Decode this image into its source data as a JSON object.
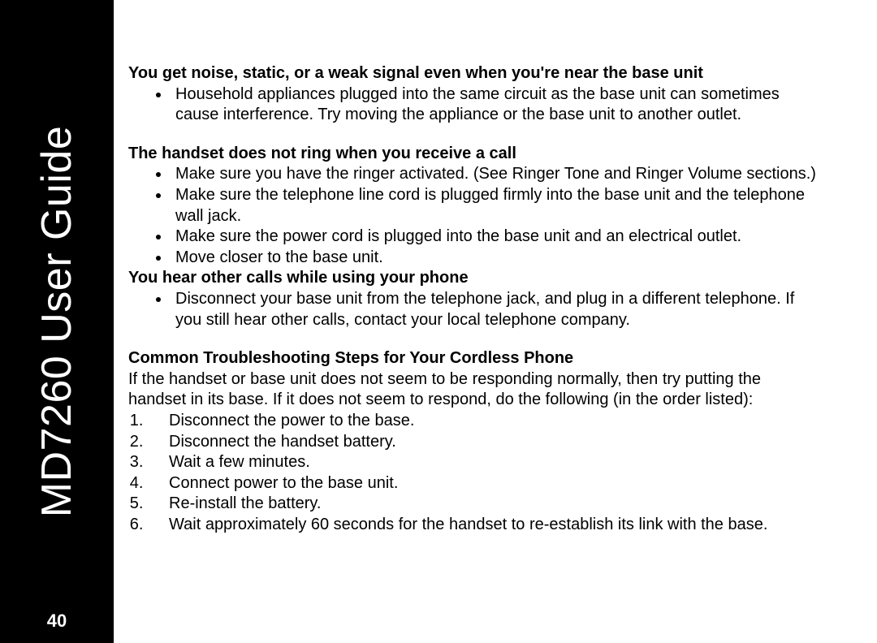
{
  "sidebar": {
    "title": "MD7260 User Guide",
    "page_number": "40"
  },
  "sections": [
    {
      "heading": "You get noise, static, or a weak signal even when you're near the base unit",
      "bullets": [
        "Household appliances plugged into the same circuit as the base unit can sometimes cause interference. Try moving the appliance or the base unit to another outlet."
      ]
    },
    {
      "heading": "The handset does not ring when you receive a call",
      "bullets": [
        "Make sure you have the ringer activated. (See Ringer Tone and Ringer Volume sections.)",
        "Make sure the telephone line cord is plugged firmly into the base unit and the telephone wall jack.",
        "Make sure the power cord is plugged into the base unit and an electrical outlet.",
        "Move closer to the base unit."
      ]
    },
    {
      "heading": "You hear other calls while using your phone",
      "bullets": [
        "Disconnect your base unit from the telephone jack, and plug in a different telephone. If you still hear other calls, contact your local telephone company."
      ]
    }
  ],
  "common": {
    "heading": "Common Troubleshooting Steps for Your Cordless Phone",
    "intro": "If the handset or base unit does not seem to be responding normally, then try putting the handset in its base. If it does not seem to respond, do the following (in the order listed):",
    "steps": [
      "Disconnect the power to the base.",
      "Disconnect the handset battery.",
      "Wait a few minutes.",
      "Connect power to the base unit.",
      "Re-install the battery.",
      "Wait approximately 60 seconds for the handset to re-establish its link with the base."
    ]
  }
}
